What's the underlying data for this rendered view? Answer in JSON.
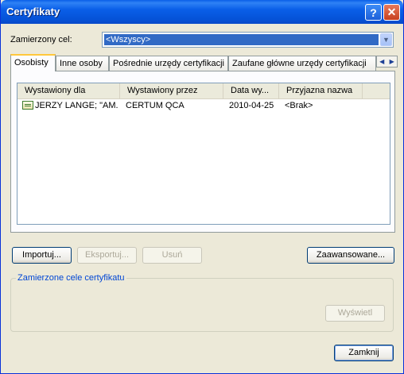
{
  "window": {
    "title": "Certyfikaty",
    "help_icon": "question-mark",
    "close_icon": "x"
  },
  "target": {
    "label": "Zamierzony cel:",
    "value": "<Wszyscy>"
  },
  "tabs": [
    {
      "label": "Osobisty"
    },
    {
      "label": "Inne osoby"
    },
    {
      "label": "Pośrednie urzędy certyfikacji"
    },
    {
      "label": "Zaufane główne urzędy certyfikacji"
    }
  ],
  "table": {
    "columns": [
      "Wystawiony dla",
      "Wystawiony przez",
      "Data wy...",
      "Przyjazna nazwa"
    ],
    "rows": [
      {
        "issued_to": "JERZY LANGE; \"AM...",
        "issued_by": "CERTUM QCA",
        "date": "2010-04-25",
        "friendly_name": "<Brak>"
      }
    ]
  },
  "buttons": {
    "import": "Importuj...",
    "export": "Eksportuj...",
    "remove": "Usuń",
    "advanced": "Zaawansowane...",
    "view": "Wyświetl",
    "close": "Zamknij"
  },
  "purposes_group": {
    "label": "Zamierzone cele certyfikatu"
  }
}
